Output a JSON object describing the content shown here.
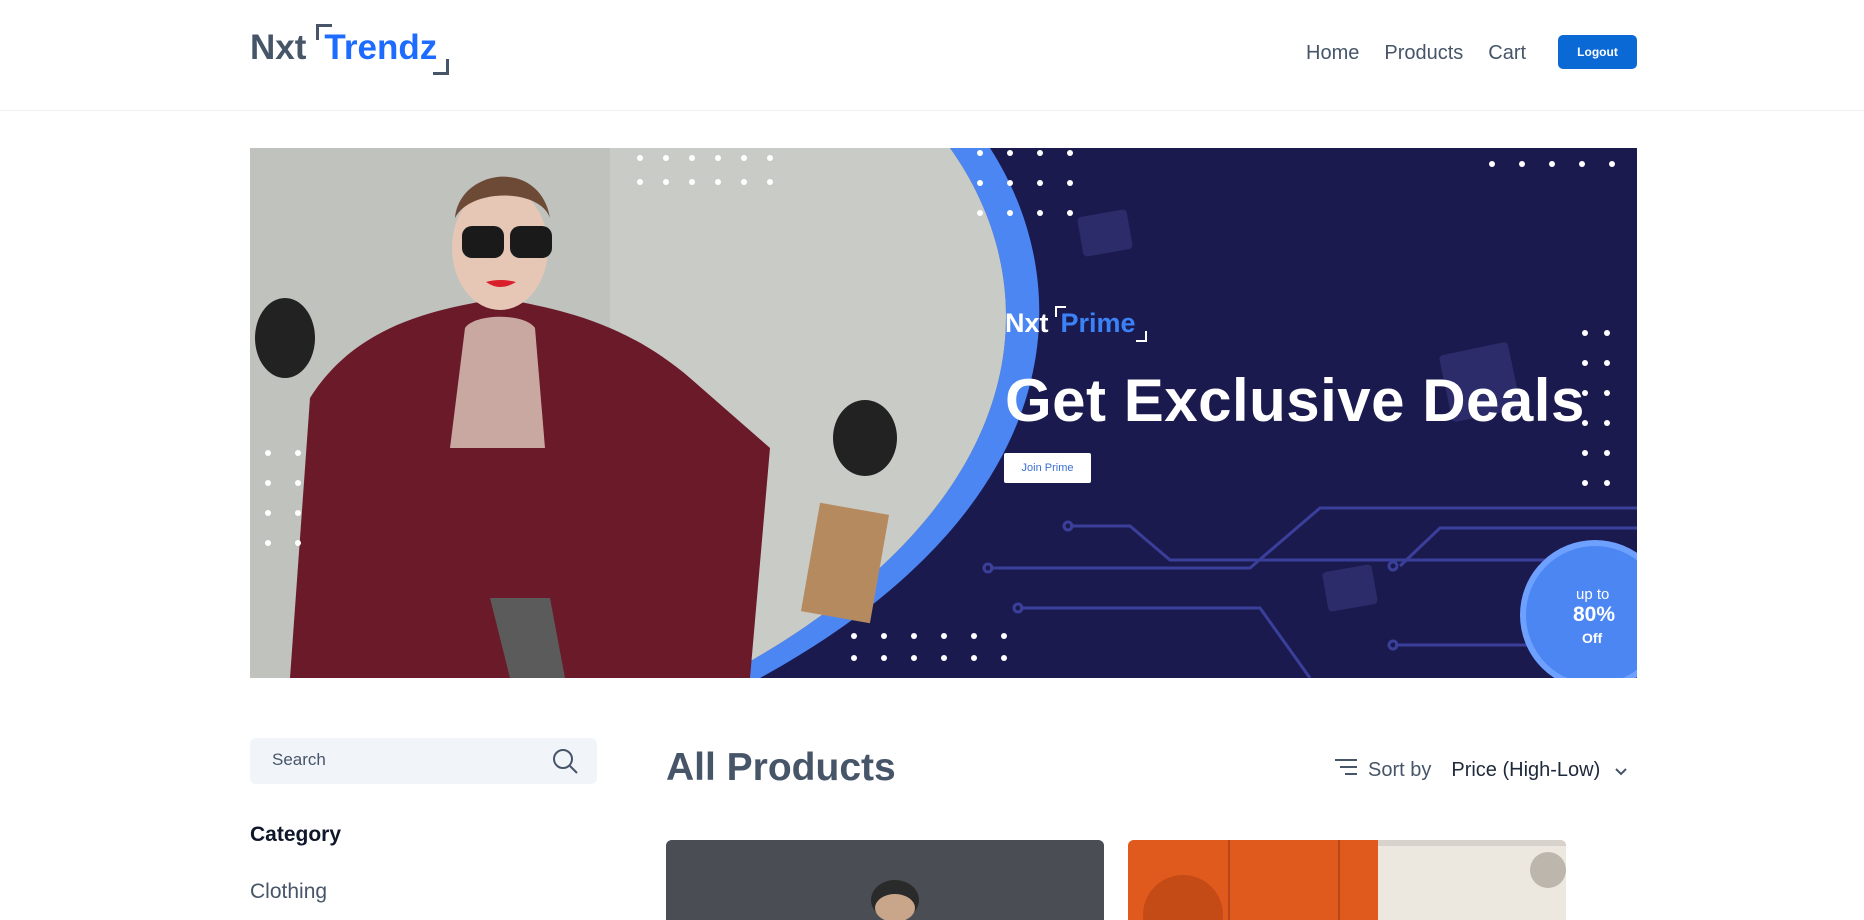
{
  "header": {
    "logo_prefix": "Nxt",
    "logo_brand": "Trendz",
    "nav": [
      "Home",
      "Products",
      "Cart"
    ],
    "logout_label": "Logout"
  },
  "banner": {
    "logo_prefix": "Nxt",
    "logo_brand": "Prime",
    "title": "Get Exclusive Deals",
    "button_label": "Join Prime",
    "discount": {
      "line1": "up to",
      "line2": "80%",
      "line3": "Off"
    }
  },
  "search": {
    "placeholder": "Search"
  },
  "filters": {
    "category_heading": "Category",
    "categories": [
      "Clothing"
    ]
  },
  "products": {
    "heading": "All Products",
    "sort_label": "Sort by",
    "sort_value": "Price (High-Low)"
  },
  "colors": {
    "accent": "#1e6bff",
    "logout": "#0b69d6",
    "banner_bg": "#1b1a4f"
  }
}
